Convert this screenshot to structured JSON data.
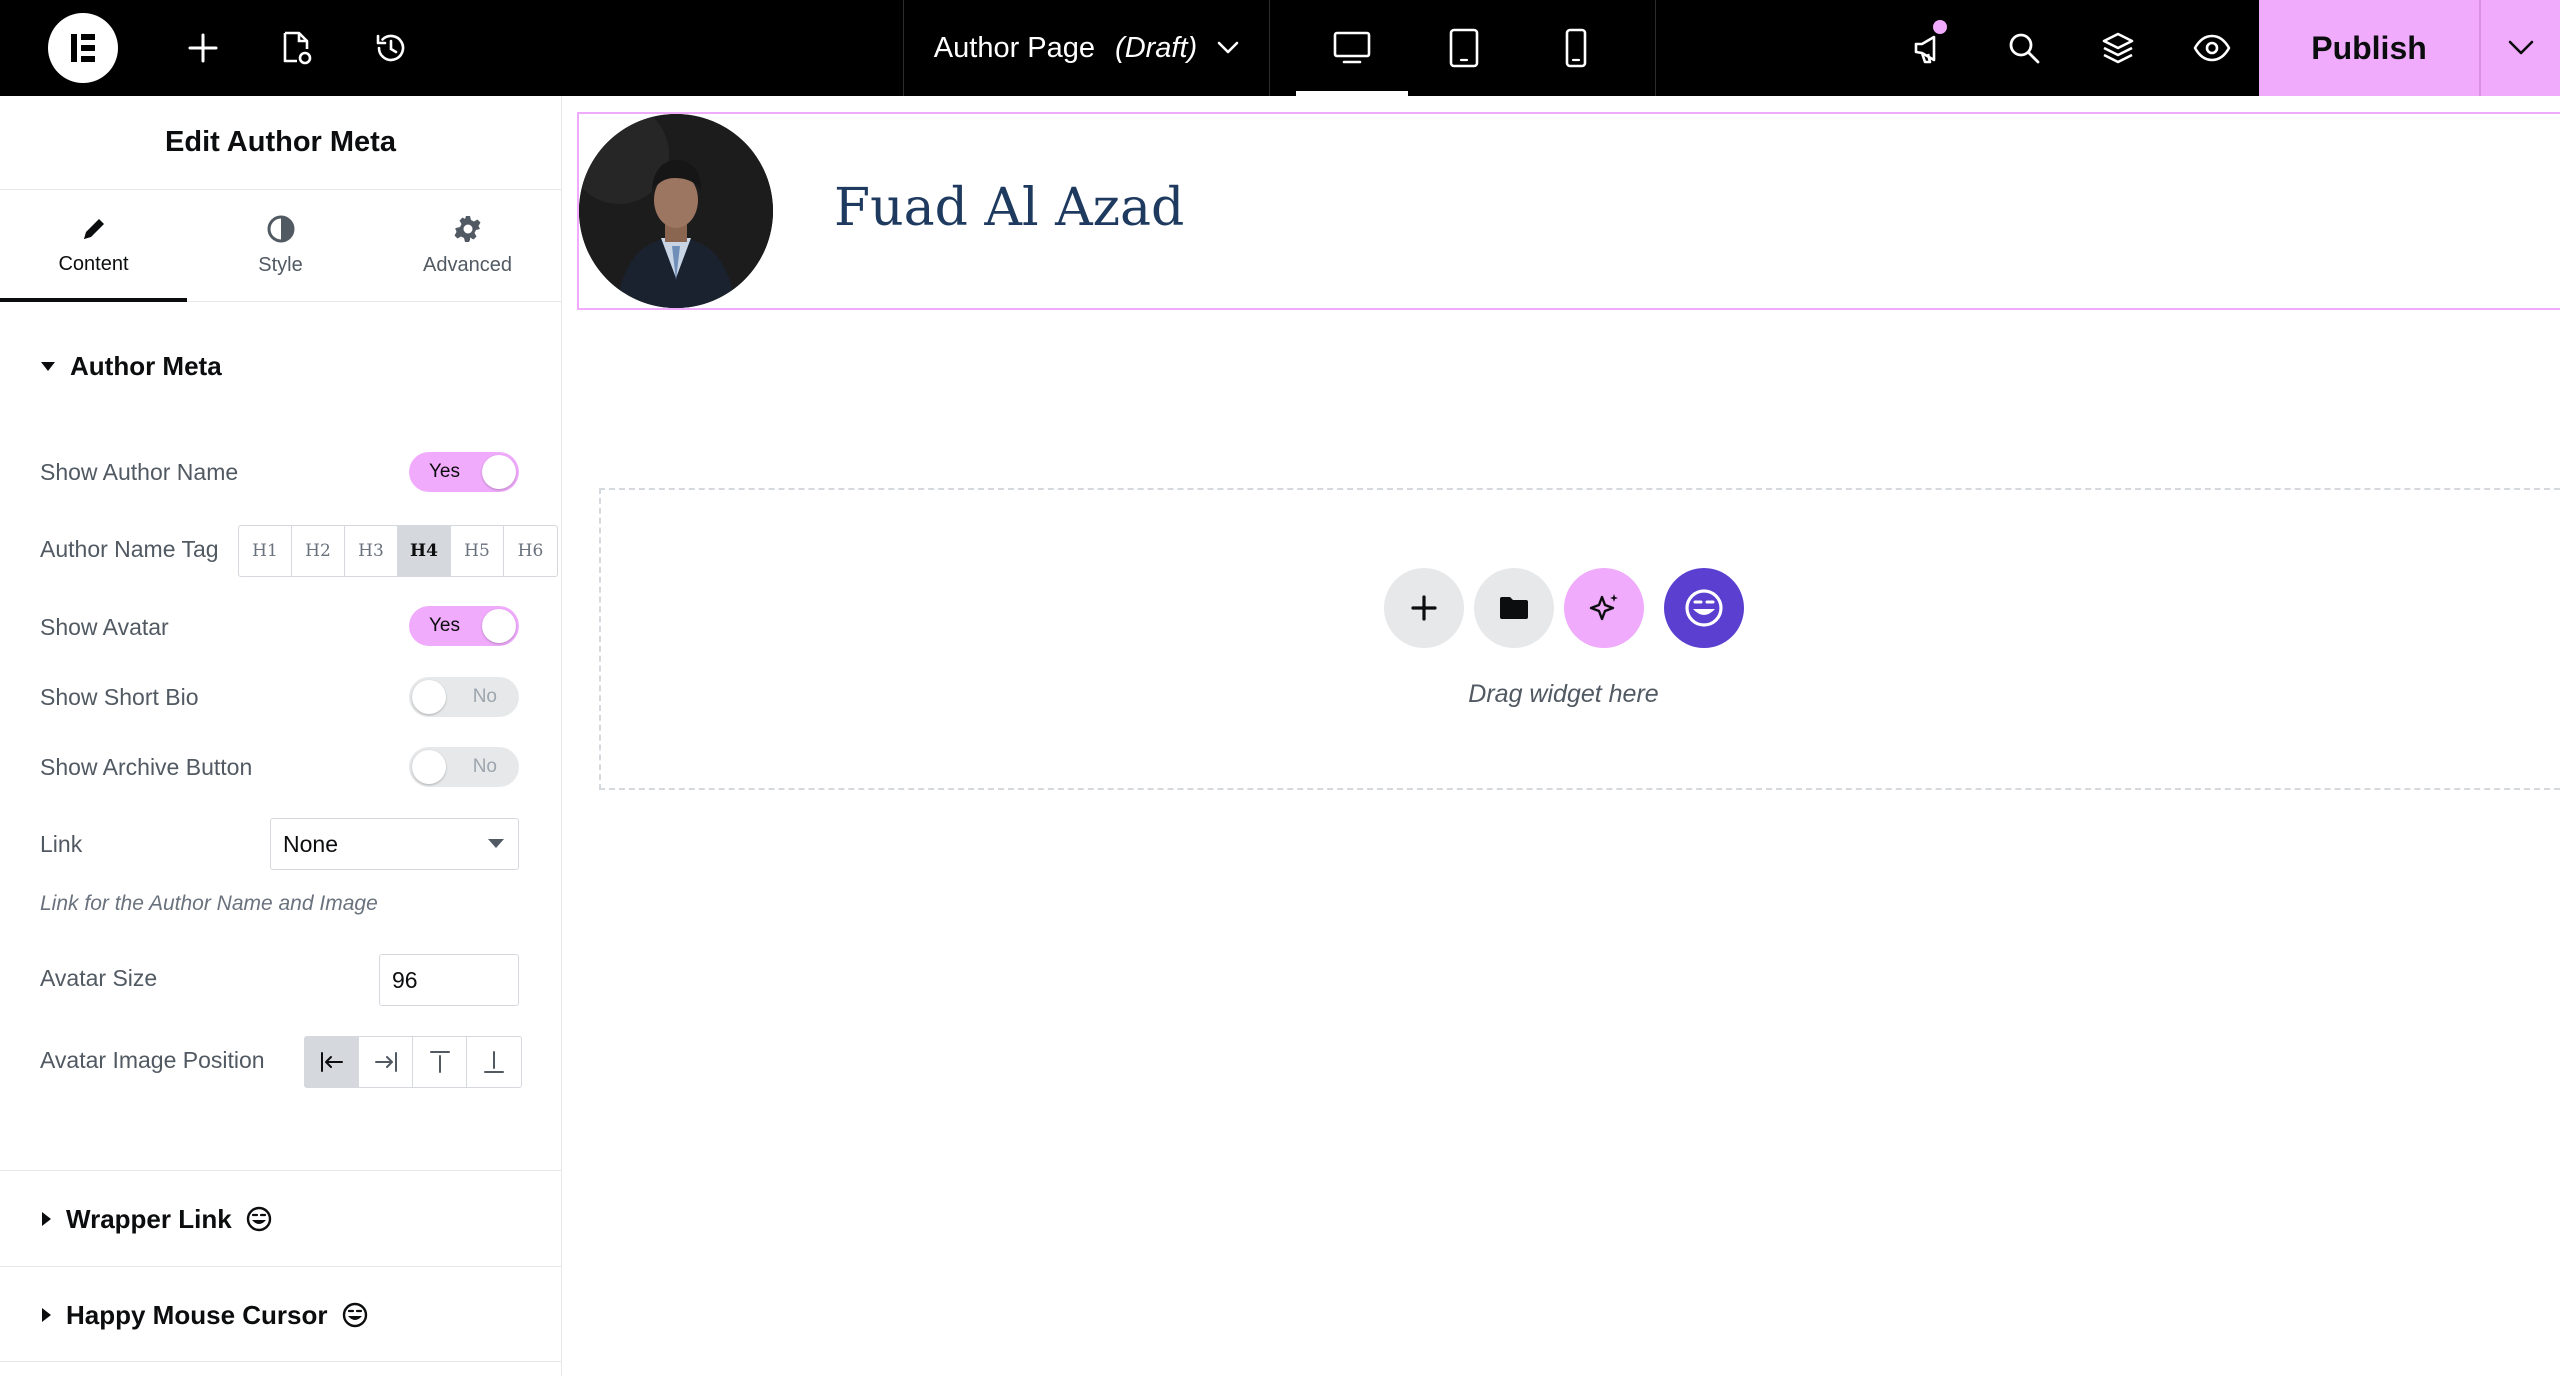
{
  "colors": {
    "accent_pink": "#f0abfc",
    "topbar_bg": "#000000",
    "author_name_color": "#1e3a5f",
    "happy_addons_purple": "#5b3fd0"
  },
  "topbar": {
    "document_title": "Author Page",
    "document_status": "(Draft)",
    "publish_label": "Publish",
    "icons": [
      "elementor-logo-icon",
      "add-element-icon",
      "page-settings-icon",
      "history-icon",
      "desktop-icon",
      "tablet-icon",
      "mobile-icon",
      "notifications-icon",
      "search-icon",
      "structure-layers-icon",
      "preview-eye-icon",
      "chevron-down-icon"
    ]
  },
  "panel": {
    "title": "Edit Author Meta",
    "tabs": [
      {
        "label": "Content",
        "active": true
      },
      {
        "label": "Style",
        "active": false
      },
      {
        "label": "Advanced",
        "active": false
      }
    ],
    "section_title": "Author Meta",
    "controls": {
      "show_author_name": {
        "label": "Show Author Name",
        "value": "Yes"
      },
      "author_name_tag": {
        "label": "Author Name Tag",
        "options": [
          "H1",
          "H2",
          "H3",
          "H4",
          "H5",
          "H6"
        ],
        "selected": "H4"
      },
      "show_avatar": {
        "label": "Show Avatar",
        "value": "Yes"
      },
      "show_short_bio": {
        "label": "Show Short Bio",
        "value": "No"
      },
      "show_archive_button": {
        "label": "Show Archive Button",
        "value": "No"
      },
      "link": {
        "label": "Link",
        "value": "None",
        "hint": "Link for the Author Name and Image"
      },
      "avatar_size": {
        "label": "Avatar Size",
        "value": "96"
      },
      "avatar_image_position": {
        "label": "Avatar Image Position",
        "options": [
          "left",
          "right",
          "top",
          "bottom"
        ],
        "selected": "left"
      }
    },
    "collapsed_sections": [
      {
        "label": "Wrapper Link"
      },
      {
        "label": "Happy Mouse Cursor"
      }
    ]
  },
  "canvas": {
    "author_name": "Fuad Al Azad",
    "drop_zone_text": "Drag widget here"
  }
}
